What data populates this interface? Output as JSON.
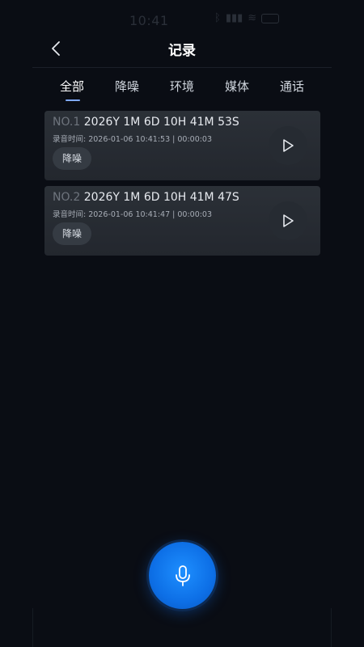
{
  "status_bar": {
    "time": "10:41"
  },
  "header": {
    "title": "记录"
  },
  "tabs": [
    {
      "label": "全部",
      "active": true
    },
    {
      "label": "降噪",
      "active": false
    },
    {
      "label": "环境",
      "active": false
    },
    {
      "label": "媒体",
      "active": false
    },
    {
      "label": "通话",
      "active": false
    }
  ],
  "records": [
    {
      "no": "NO.1",
      "name": "2026Y 1M 6D 10H 41M 53S",
      "meta": "录音时间: 2026-01-06 10:41:53 | 00:00:03",
      "tag": "降噪"
    },
    {
      "no": "NO.2",
      "name": "2026Y 1M 6D 10H 41M 47S",
      "meta": "录音时间: 2026-01-06 10:41:47 | 00:00:03",
      "tag": "降噪"
    }
  ],
  "colors": {
    "background": "#0a0d14",
    "card": "#2b3037",
    "accent": "#1e8fff",
    "tab_underline": "#7fa9ff"
  }
}
